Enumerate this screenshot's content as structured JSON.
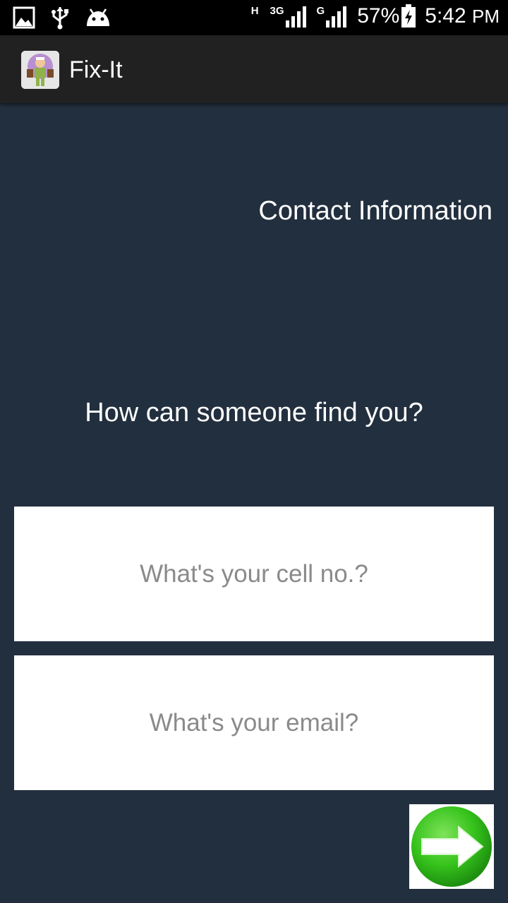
{
  "status_bar": {
    "left_icons": [
      "image-icon",
      "usb-icon",
      "android-icon"
    ],
    "network_1": "H",
    "network_2": "3G",
    "network_3": "G",
    "battery": "57%",
    "time": "5:42",
    "ampm": "PM"
  },
  "action_bar": {
    "title": "Fix-It",
    "icon": "app-logo-icon"
  },
  "main": {
    "heading": "Contact Information",
    "question": "How can someone find you?",
    "cell_input": {
      "value": "",
      "placeholder": "What's your cell no.?"
    },
    "email_input": {
      "value": "",
      "placeholder": "What's your email?"
    },
    "next_button": {
      "icon": "green-right-arrow-icon",
      "color": "#35c21b"
    }
  },
  "colors": {
    "background": "#222f3e",
    "action_bar": "#212121",
    "status_bar": "#000000"
  }
}
